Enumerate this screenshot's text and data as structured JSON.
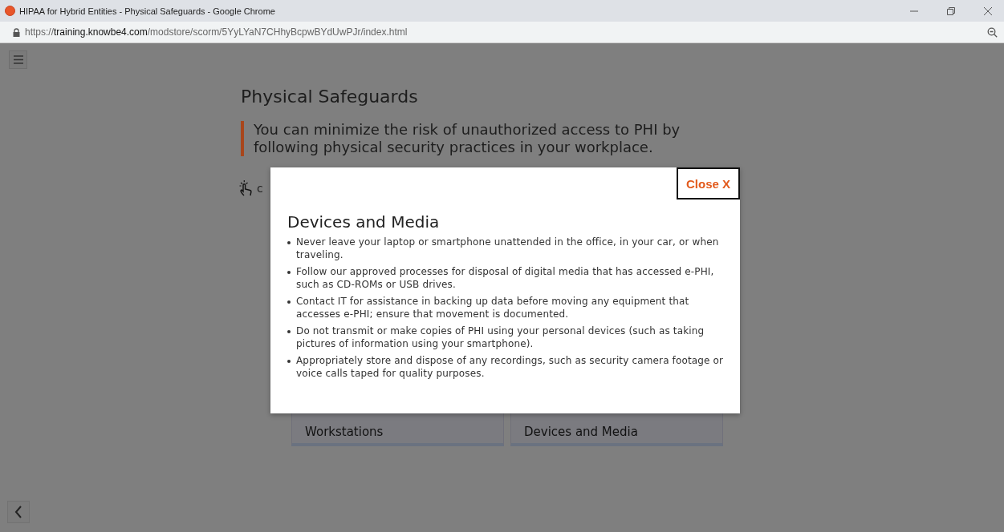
{
  "window": {
    "title": "HIPAA for Hybrid Entities - Physical Safeguards - Google Chrome"
  },
  "address_bar": {
    "url": "https://**training.knowbe4.com**/modstore/scorm/5YyLYaN7CHhyBcpwBYdUwPJr/index.html"
  },
  "page": {
    "title": "Physical Safeguards",
    "callout": "You can minimize the risk of unauthorized access to PHI by following physical security practices in your workplace.",
    "hint": "c",
    "cards": [
      {
        "label": "Workstations"
      },
      {
        "label": "Devices and Media"
      }
    ]
  },
  "modal": {
    "close_label": "Close X",
    "heading": "Devices and Media",
    "bullets": [
      "Never leave your laptop or smartphone unattended in the office, in your car, or when traveling.",
      "Follow our approved processes for disposal of digital media that has accessed e-PHI, such as CD-ROMs or USB drives.",
      "Contact IT for assistance in backing up data before moving any equipment that accesses e-PHI; ensure that movement is documented.",
      "Do not transmit or make copies of PHI using your personal devices (such as taking pictures of information using your smartphone).",
      "Appropriately store and dispose of any recordings, such as security camera footage or voice calls taped for quality purposes."
    ]
  }
}
